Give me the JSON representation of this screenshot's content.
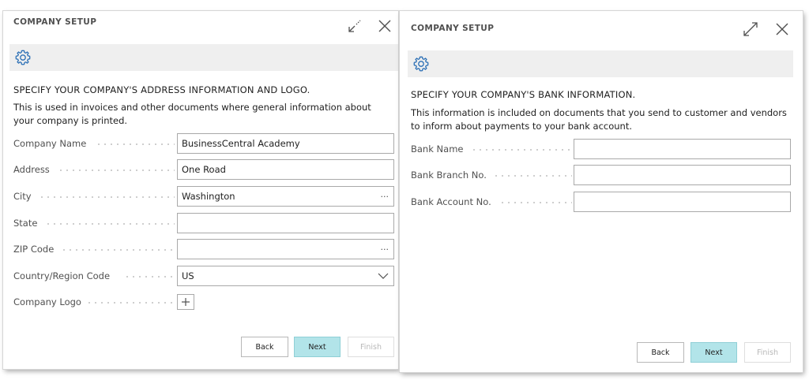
{
  "left_dialog": {
    "title": "COMPANY SETUP",
    "heading": "SPECIFY YOUR COMPANY'S ADDRESS INFORMATION AND LOGO.",
    "description": "This is used in invoices and other documents where general information about your company is printed.",
    "fields": [
      {
        "label": "Company Name",
        "value": "BusinessCentral Academy"
      },
      {
        "label": "Address",
        "value": "One Road"
      },
      {
        "label": "City",
        "value": "Washington",
        "trail": "···"
      },
      {
        "label": "State",
        "value": ""
      },
      {
        "label": "ZIP Code",
        "value": "",
        "trail": "···"
      },
      {
        "label": "Country/Region Code",
        "value": "US"
      },
      {
        "label": "Company Logo"
      }
    ],
    "buttons": {
      "back": "Back",
      "next": "Next",
      "finish": "Finish"
    }
  },
  "right_dialog": {
    "title": "COMPANY SETUP",
    "heading": "SPECIFY YOUR COMPANY'S BANK INFORMATION.",
    "description": "This information is included on documents that you send to customer and vendors to inform about payments to your bank account.",
    "fields": [
      {
        "label": "Bank Name",
        "value": ""
      },
      {
        "label": "Bank Branch No.",
        "value": ""
      },
      {
        "label": "Bank Account No.",
        "value": ""
      }
    ],
    "buttons": {
      "back": "Back",
      "next": "Next",
      "finish": "Finish"
    }
  },
  "icons": {
    "gear": "gear-icon",
    "collapse": "collapse-arrows-icon",
    "expand": "expand-arrows-icon",
    "close": "close-icon",
    "lookup": "ellipsis-icon",
    "dropdown": "chevron-down-icon",
    "add": "plus-icon"
  },
  "colors": {
    "gear_blue": "#2b6fb5",
    "gear_bar": "#efefef",
    "primary_button": "#b2e4e9",
    "text": "#212121",
    "label": "#505050"
  }
}
